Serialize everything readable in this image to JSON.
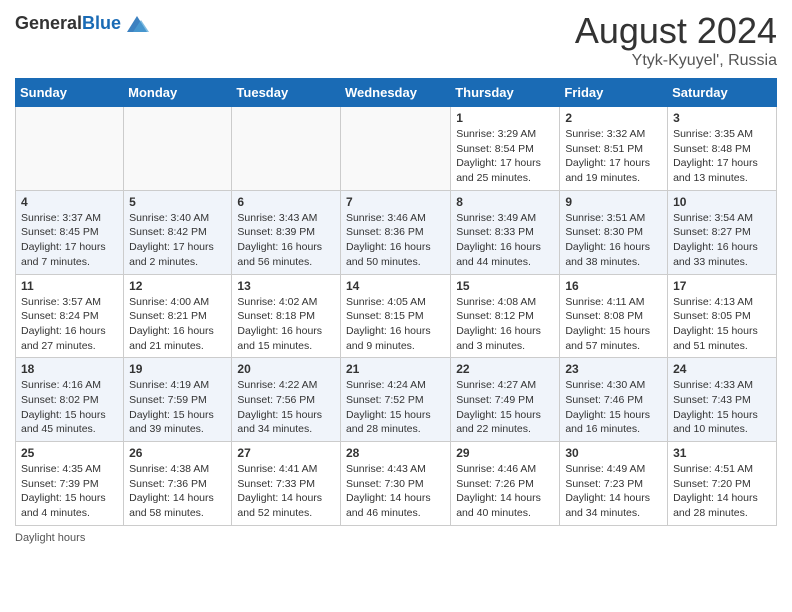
{
  "header": {
    "logo_general": "General",
    "logo_blue": "Blue",
    "month_year": "August 2024",
    "location": "Ytyk-Kyuyel', Russia"
  },
  "weekdays": [
    "Sunday",
    "Monday",
    "Tuesday",
    "Wednesday",
    "Thursday",
    "Friday",
    "Saturday"
  ],
  "footer": {
    "daylight_hours": "Daylight hours"
  },
  "weeks": [
    [
      {
        "day": "",
        "sunrise": "",
        "sunset": "",
        "daylight": ""
      },
      {
        "day": "",
        "sunrise": "",
        "sunset": "",
        "daylight": ""
      },
      {
        "day": "",
        "sunrise": "",
        "sunset": "",
        "daylight": ""
      },
      {
        "day": "",
        "sunrise": "",
        "sunset": "",
        "daylight": ""
      },
      {
        "day": "1",
        "sunrise": "3:29 AM",
        "sunset": "8:54 PM",
        "daylight": "17 hours and 25 minutes."
      },
      {
        "day": "2",
        "sunrise": "3:32 AM",
        "sunset": "8:51 PM",
        "daylight": "17 hours and 19 minutes."
      },
      {
        "day": "3",
        "sunrise": "3:35 AM",
        "sunset": "8:48 PM",
        "daylight": "17 hours and 13 minutes."
      }
    ],
    [
      {
        "day": "4",
        "sunrise": "3:37 AM",
        "sunset": "8:45 PM",
        "daylight": "17 hours and 7 minutes."
      },
      {
        "day": "5",
        "sunrise": "3:40 AM",
        "sunset": "8:42 PM",
        "daylight": "17 hours and 2 minutes."
      },
      {
        "day": "6",
        "sunrise": "3:43 AM",
        "sunset": "8:39 PM",
        "daylight": "16 hours and 56 minutes."
      },
      {
        "day": "7",
        "sunrise": "3:46 AM",
        "sunset": "8:36 PM",
        "daylight": "16 hours and 50 minutes."
      },
      {
        "day": "8",
        "sunrise": "3:49 AM",
        "sunset": "8:33 PM",
        "daylight": "16 hours and 44 minutes."
      },
      {
        "day": "9",
        "sunrise": "3:51 AM",
        "sunset": "8:30 PM",
        "daylight": "16 hours and 38 minutes."
      },
      {
        "day": "10",
        "sunrise": "3:54 AM",
        "sunset": "8:27 PM",
        "daylight": "16 hours and 33 minutes."
      }
    ],
    [
      {
        "day": "11",
        "sunrise": "3:57 AM",
        "sunset": "8:24 PM",
        "daylight": "16 hours and 27 minutes."
      },
      {
        "day": "12",
        "sunrise": "4:00 AM",
        "sunset": "8:21 PM",
        "daylight": "16 hours and 21 minutes."
      },
      {
        "day": "13",
        "sunrise": "4:02 AM",
        "sunset": "8:18 PM",
        "daylight": "16 hours and 15 minutes."
      },
      {
        "day": "14",
        "sunrise": "4:05 AM",
        "sunset": "8:15 PM",
        "daylight": "16 hours and 9 minutes."
      },
      {
        "day": "15",
        "sunrise": "4:08 AM",
        "sunset": "8:12 PM",
        "daylight": "16 hours and 3 minutes."
      },
      {
        "day": "16",
        "sunrise": "4:11 AM",
        "sunset": "8:08 PM",
        "daylight": "15 hours and 57 minutes."
      },
      {
        "day": "17",
        "sunrise": "4:13 AM",
        "sunset": "8:05 PM",
        "daylight": "15 hours and 51 minutes."
      }
    ],
    [
      {
        "day": "18",
        "sunrise": "4:16 AM",
        "sunset": "8:02 PM",
        "daylight": "15 hours and 45 minutes."
      },
      {
        "day": "19",
        "sunrise": "4:19 AM",
        "sunset": "7:59 PM",
        "daylight": "15 hours and 39 minutes."
      },
      {
        "day": "20",
        "sunrise": "4:22 AM",
        "sunset": "7:56 PM",
        "daylight": "15 hours and 34 minutes."
      },
      {
        "day": "21",
        "sunrise": "4:24 AM",
        "sunset": "7:52 PM",
        "daylight": "15 hours and 28 minutes."
      },
      {
        "day": "22",
        "sunrise": "4:27 AM",
        "sunset": "7:49 PM",
        "daylight": "15 hours and 22 minutes."
      },
      {
        "day": "23",
        "sunrise": "4:30 AM",
        "sunset": "7:46 PM",
        "daylight": "15 hours and 16 minutes."
      },
      {
        "day": "24",
        "sunrise": "4:33 AM",
        "sunset": "7:43 PM",
        "daylight": "15 hours and 10 minutes."
      }
    ],
    [
      {
        "day": "25",
        "sunrise": "4:35 AM",
        "sunset": "7:39 PM",
        "daylight": "15 hours and 4 minutes."
      },
      {
        "day": "26",
        "sunrise": "4:38 AM",
        "sunset": "7:36 PM",
        "daylight": "14 hours and 58 minutes."
      },
      {
        "day": "27",
        "sunrise": "4:41 AM",
        "sunset": "7:33 PM",
        "daylight": "14 hours and 52 minutes."
      },
      {
        "day": "28",
        "sunrise": "4:43 AM",
        "sunset": "7:30 PM",
        "daylight": "14 hours and 46 minutes."
      },
      {
        "day": "29",
        "sunrise": "4:46 AM",
        "sunset": "7:26 PM",
        "daylight": "14 hours and 40 minutes."
      },
      {
        "day": "30",
        "sunrise": "4:49 AM",
        "sunset": "7:23 PM",
        "daylight": "14 hours and 34 minutes."
      },
      {
        "day": "31",
        "sunrise": "4:51 AM",
        "sunset": "7:20 PM",
        "daylight": "14 hours and 28 minutes."
      }
    ]
  ]
}
